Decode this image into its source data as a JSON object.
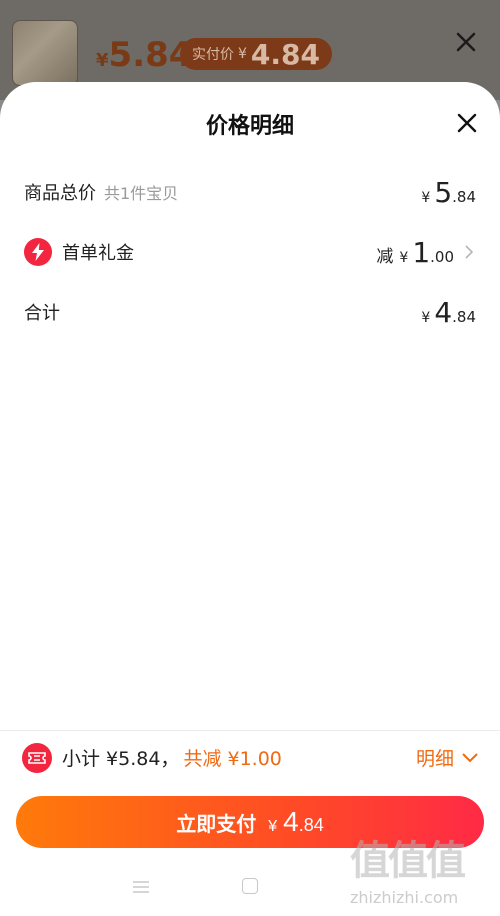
{
  "background_header": {
    "price_currency": "¥",
    "price": "5.84",
    "pill_label": "实付价",
    "pill_currency": "¥",
    "pill_price": "4.84"
  },
  "sheet": {
    "title": "价格明细",
    "rows": {
      "goods_total": {
        "label": "商品总价",
        "sub": "共1件宝贝",
        "currency": "¥",
        "int": "5",
        "dec": ".84"
      },
      "coupon": {
        "icon": "lightning-icon",
        "label": "首单礼金",
        "cut_label": "减",
        "currency": "¥",
        "int": "1",
        "dec": ".00"
      },
      "total": {
        "label": "合计",
        "currency": "¥",
        "int": "4",
        "dec": ".84"
      }
    }
  },
  "summary": {
    "icon": "ticket-icon",
    "subtotal_text": "小计 ¥5.84，",
    "saved_text": "共减 ¥1.00",
    "detail_label": "明细"
  },
  "pay_button": {
    "label": "立即支付",
    "currency": "¥",
    "int": "4",
    "dec": ".84"
  },
  "watermark": {
    "text": "zhizhizhi.com"
  },
  "colors": {
    "accent": "#f06a12",
    "badge_red": "#f2263f",
    "button_gradient_start": "#ff7a0a",
    "button_gradient_end": "#ff2a46"
  }
}
